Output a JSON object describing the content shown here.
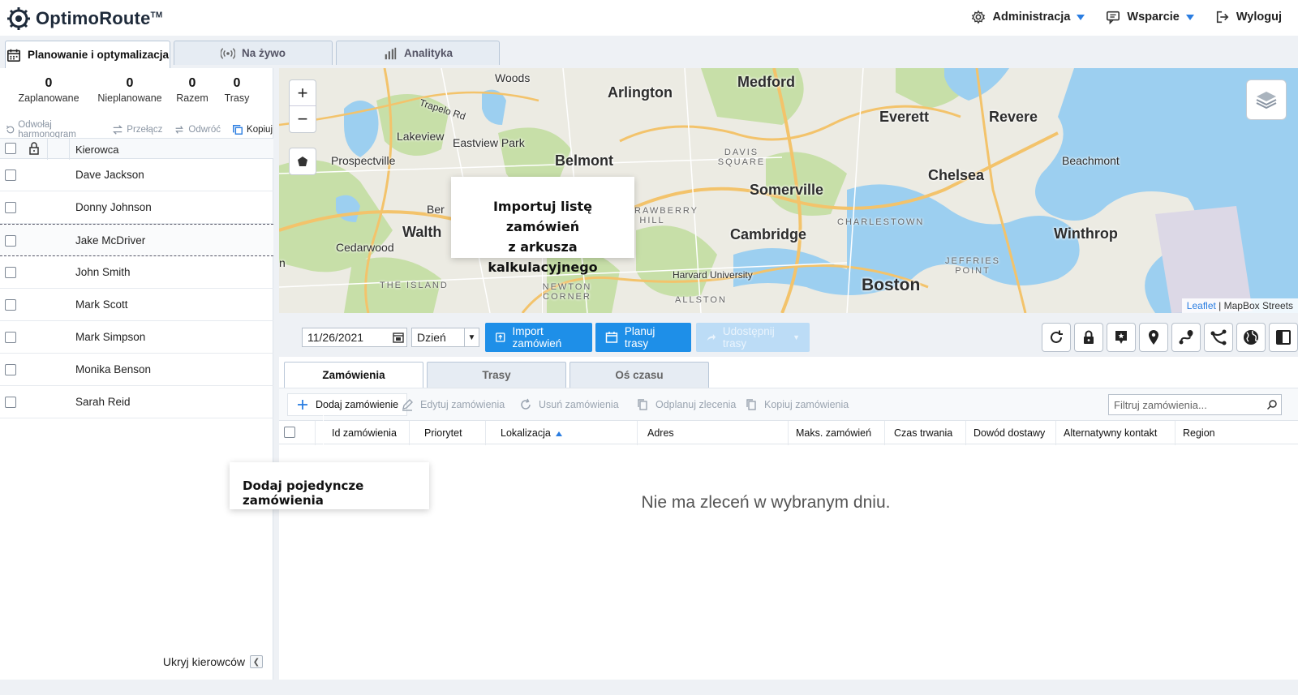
{
  "header": {
    "brand": "OptimoRoute",
    "brand_tm": "TM",
    "nav": [
      {
        "label": "Administracja",
        "icon": "gear-icon",
        "dropdown": true
      },
      {
        "label": "Wsparcie",
        "icon": "chat-icon",
        "dropdown": true
      },
      {
        "label": "Wyloguj",
        "icon": "logout-icon",
        "dropdown": false
      }
    ]
  },
  "main_tabs": [
    {
      "label": "Planowanie i optymalizacja",
      "icon": "calendar-icon",
      "active": true
    },
    {
      "label": "Na żywo",
      "icon": "broadcast-icon",
      "active": false
    },
    {
      "label": "Analityka",
      "icon": "bar-chart-icon",
      "active": false
    }
  ],
  "stats": [
    {
      "value": "0",
      "label": "Zaplanowane"
    },
    {
      "value": "0",
      "label": "Nieplanowane"
    },
    {
      "value": "0",
      "label": "Razem"
    },
    {
      "value": "0",
      "label": "Trasy"
    }
  ],
  "driver_actions": [
    {
      "label": "Odwołaj harmonogram",
      "icon": "undo-icon",
      "enabled": false
    },
    {
      "label": "Przełącz",
      "icon": "switch-icon",
      "enabled": false
    },
    {
      "label": "Odwróć",
      "icon": "reverse-icon",
      "enabled": false
    },
    {
      "label": "Kopiuj",
      "icon": "copy-icon",
      "enabled": true
    }
  ],
  "driver_table": {
    "column_driver": "Kierowca",
    "drivers": [
      "Dave Jackson",
      "Donny Johnson",
      "Jake McDriver",
      "John Smith",
      "Mark Scott",
      "Mark Simpson",
      "Monika Benson",
      "Sarah Reid"
    ],
    "highlighted_index": 2
  },
  "hide_drivers_label": "Ukryj kierowców",
  "map": {
    "labels": {
      "arlington": "Arlington",
      "medford": "Medford",
      "everett": "Everett",
      "revere": "Revere",
      "chelsea": "Chelsea",
      "beachmont": "Beachmont",
      "somerville": "Somerville",
      "cambridge": "Cambridge",
      "winthrop": "Winthrop",
      "boston": "Boston",
      "belmont": "Belmont",
      "lakeview": "Lakeview",
      "eastview": "Eastview Park",
      "prospectville": "Prospectville",
      "cedarwood": "Cedarwood",
      "waltham": "Walth",
      "harvard": "Harvard University",
      "davis": "DAVIS SQUARE",
      "charlestown": "CHARLESTOWN",
      "jeffries": "JEFFRIES POINT",
      "newton": "NEWTON CORNER",
      "allston": "ALLSTON",
      "island": "THE ISLAND",
      "strawberry": "STRAWBERRY HILL",
      "woods": "Woods",
      "trapelo": "Trapelo Rd",
      "ber": "Ber",
      "n": "n"
    },
    "attribution_link": "Leaflet",
    "attribution_text": "| MapBox Streets",
    "zoom_in": "+",
    "zoom_out": "−"
  },
  "callouts": {
    "import_line1": "Importuj listę zamówień",
    "import_line2": "z arkusza kalkulacyjnego",
    "add_single": "Dodaj pojedyncze zamówienia"
  },
  "toolbar": {
    "date": "11/26/2021",
    "period": "Dzień",
    "import_label": "Import zamówień",
    "plan_label": "Planuj trasy",
    "share_label": "Udostępnij trasy",
    "icon_buttons": [
      "refresh-icon",
      "lock-icon",
      "marker-add-icon",
      "location-pin-icon",
      "route-icon",
      "route-split-icon",
      "globe-icon",
      "sidebar-toggle-icon"
    ]
  },
  "sub_tabs": [
    {
      "label": "Zamówienia",
      "active": true
    },
    {
      "label": "Trasy",
      "active": false
    },
    {
      "label": "Oś czasu",
      "active": false
    }
  ],
  "order_actions": [
    {
      "label": "Dodaj zamówienie",
      "icon": "plus-icon",
      "enabled": true
    },
    {
      "label": "Edytuj zamówienia",
      "icon": "edit-icon",
      "enabled": false
    },
    {
      "label": "Usuń zamówienia",
      "icon": "delete-icon",
      "enabled": false
    },
    {
      "label": "Odplanuj zlecenia",
      "icon": "unplan-icon",
      "enabled": false
    },
    {
      "label": "Kopiuj zamówienia",
      "icon": "copy-icon",
      "enabled": false
    }
  ],
  "filter_placeholder": "Filtruj zamówienia...",
  "order_table": {
    "columns": [
      "Id zamówienia",
      "Priorytet",
      "Lokalizacja",
      "Adres",
      "Maks. zamówień",
      "Czas trwania",
      "Dowód dostawy",
      "Alternatywny kontakt",
      "Region"
    ],
    "sorted_column": "Lokalizacja",
    "empty_message": "Nie ma zleceń w wybranym dniu."
  },
  "colors": {
    "accent": "#1e8fe8",
    "water": "#9ccff0",
    "park": "#c7dfa8",
    "highway": "#f3c36b"
  }
}
